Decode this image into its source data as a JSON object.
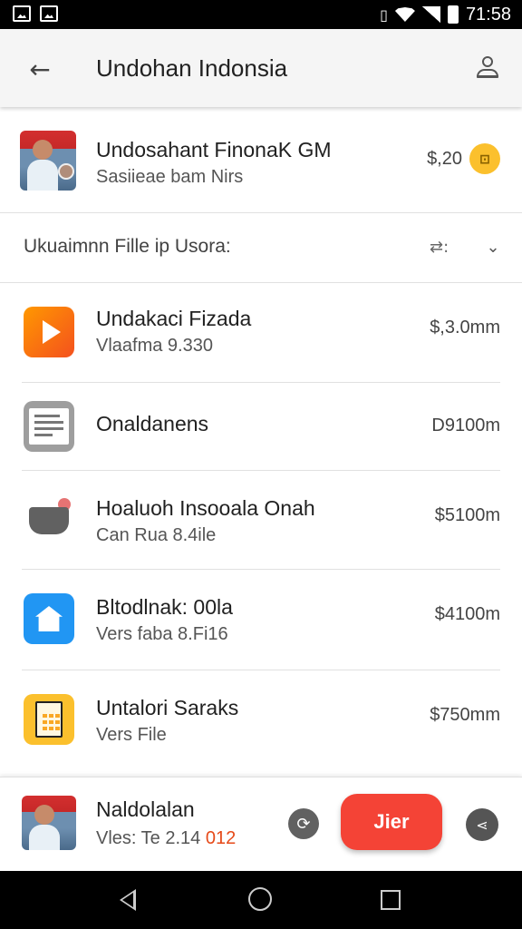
{
  "status_bar": {
    "time": "71:58",
    "icons": [
      "image-icon",
      "photo-icon",
      "vibrate-icon",
      "wifi-icon",
      "signal-icon",
      "battery-icon"
    ]
  },
  "app_bar": {
    "title": "Undohan Indonsia",
    "back_icon": "arrow-left-icon",
    "account_icon": "account-icon"
  },
  "header_item": {
    "title": "Undosahant FinonaK GM",
    "subtitle": "Sasiieae bam Nirs",
    "price": "$,20",
    "badge": "coin-icon"
  },
  "section": {
    "label": "Ukuaimnn Fille ip Usora:",
    "sort_icon": "sort-icon",
    "expand_icon": "chevron-down-icon"
  },
  "items": [
    {
      "title": "Undakaci Fizada",
      "subtitle": "Vlaafma 9.330",
      "price": "$,3.0mm",
      "icon": "play-icon"
    },
    {
      "title": "Onaldanens",
      "subtitle": "",
      "price": "D9100m",
      "icon": "document-icon"
    },
    {
      "title": "Hoaluoh Insooala Onah",
      "subtitle": "Can Rua 8.4ile",
      "price": "$5100m",
      "icon": "basket-icon"
    },
    {
      "title": "Bltodlnak: 00la",
      "subtitle": "Vers faba 8.Fi16",
      "price": "$4100m",
      "icon": "home-icon"
    },
    {
      "title": "Untalori Saraks",
      "subtitle": "Vers File",
      "price": "$750mm",
      "icon": "spreadsheet-icon"
    }
  ],
  "player": {
    "title": "Naldolalan",
    "subtitle_prefix": "Vles: Te 2.14 ",
    "subtitle_highlight": "012",
    "join_label": "Jier",
    "refresh_icon": "refresh-icon",
    "share_icon": "share-icon"
  },
  "nav": {
    "back_icon": "nav-back-icon",
    "home_icon": "nav-home-icon",
    "recents_icon": "nav-recents-icon"
  },
  "colors": {
    "accent": "#f44336",
    "coin": "#fbc02d",
    "highlight_text": "#e64a19"
  }
}
